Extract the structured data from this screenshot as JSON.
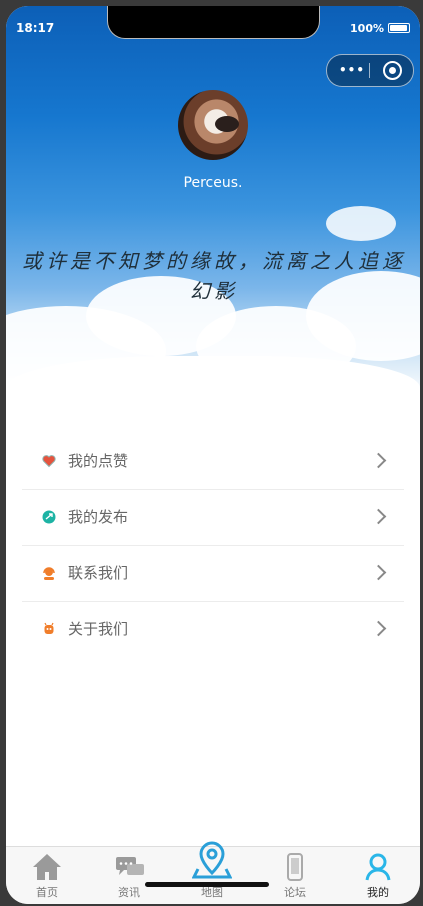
{
  "status": {
    "time": "18:17",
    "battery": "100%"
  },
  "capsule": {
    "menu_icon": "more-dots-icon",
    "close_icon": "target-close-icon"
  },
  "profile": {
    "username": "Perceus.",
    "avatar": "dog-avatar"
  },
  "quote": "或许是不知梦的缘故，流离之人追逐幻影",
  "menu": [
    {
      "label": "我的点赞",
      "icon": "heart-icon",
      "color": "#e5533d"
    },
    {
      "label": "我的发布",
      "icon": "publish-icon",
      "color": "#1db3a4"
    },
    {
      "label": "联系我们",
      "icon": "support-icon",
      "color": "#f07d2a"
    },
    {
      "label": "关于我们",
      "icon": "about-icon",
      "color": "#f07d2a"
    }
  ],
  "tabs": [
    {
      "label": "首页",
      "icon": "home-icon"
    },
    {
      "label": "资讯",
      "icon": "chat-icon"
    },
    {
      "label": "地图",
      "icon": "map-pin-icon"
    },
    {
      "label": "论坛",
      "icon": "forum-icon"
    },
    {
      "label": "我的",
      "icon": "profile-icon",
      "active": true
    }
  ],
  "colors": {
    "accent": "#2a9fd8",
    "sky": "#1677cf"
  }
}
